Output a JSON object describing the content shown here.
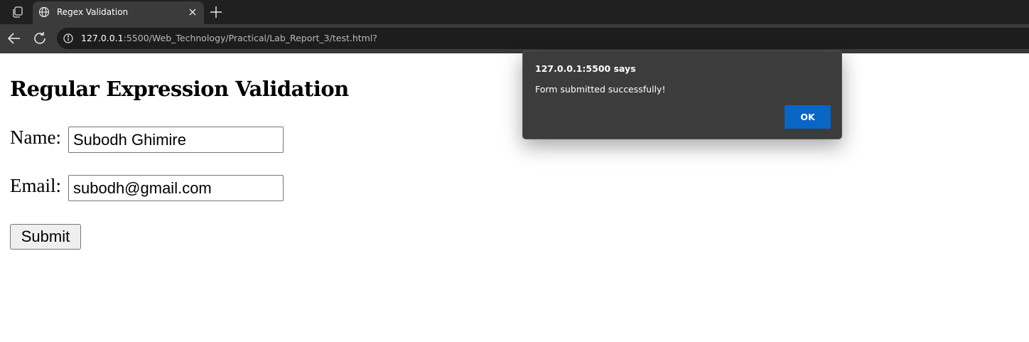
{
  "browser": {
    "tab": {
      "title": "Regex Validation",
      "favicon": "globe-icon",
      "close_icon": "close-icon"
    },
    "new_tab_icon": "plus-icon",
    "workspaces_icon": "workspaces-icon",
    "nav": {
      "back_icon": "arrow-left-icon",
      "reload_icon": "reload-icon",
      "info_icon": "info-icon"
    },
    "address": {
      "host": "127.0.0.1",
      "rest": ":5500/Web_Technology/Practical/Lab_Report_3/test.html?"
    },
    "colors": {
      "tabbar": "#202020",
      "toolbar": "#3b3b3b"
    }
  },
  "page": {
    "heading": "Regular Expression Validation",
    "name_label": "Name:",
    "name_value": "Subodh Ghimire",
    "email_label": "Email:",
    "email_value": "subodh@gmail.com",
    "submit_label": "Submit"
  },
  "alert": {
    "title": "127.0.0.1:5500 says",
    "message": "Form submitted successfully!",
    "ok_label": "OK",
    "colors": {
      "background": "#3c3c3c",
      "ok_button": "#0a66c4"
    }
  }
}
